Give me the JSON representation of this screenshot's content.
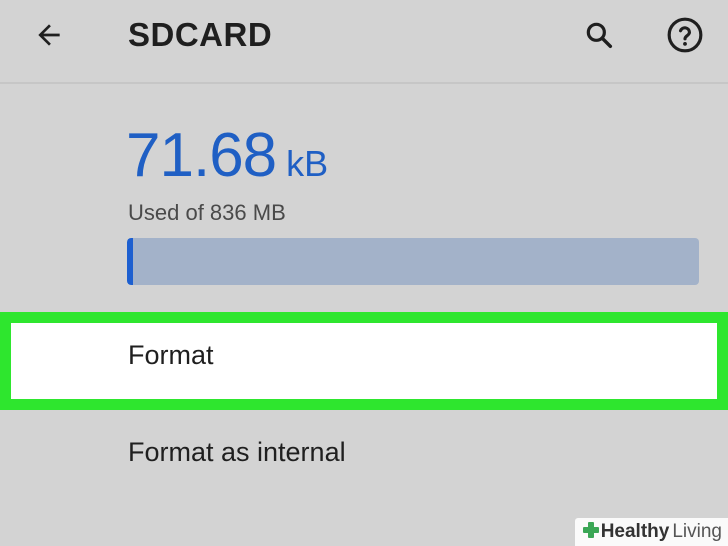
{
  "appbar": {
    "title": "SDCARD"
  },
  "storage": {
    "used_value": "71.68",
    "used_unit": "kB",
    "caption": "Used of 836 MB",
    "used_fraction": 0.01
  },
  "menu": {
    "items": [
      {
        "label": "Format",
        "highlighted": true
      },
      {
        "label": "Format as internal",
        "highlighted": false
      }
    ]
  },
  "watermark": {
    "brand_bold": "Healthy",
    "brand_regular": "Living"
  },
  "colors": {
    "accent_blue": "#1f5fc4",
    "highlight_green": "#2ee62e",
    "background": "#d3d3d3"
  }
}
